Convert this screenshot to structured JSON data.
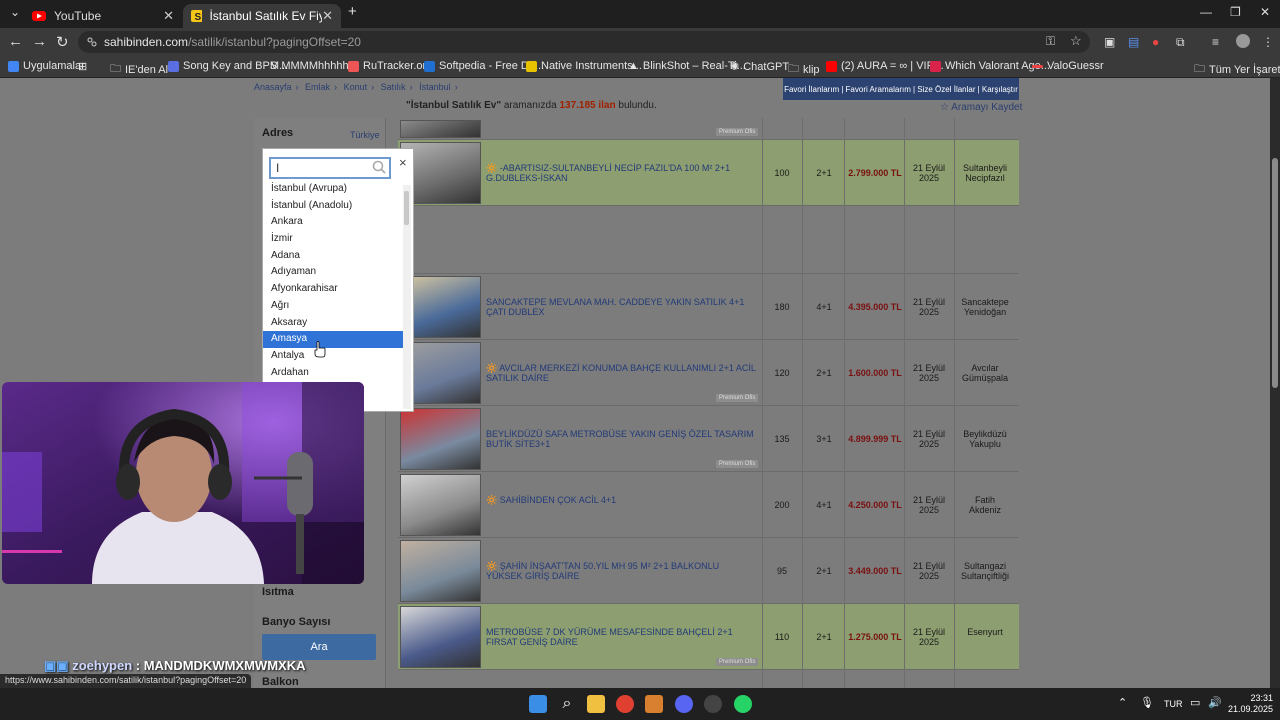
{
  "browser": {
    "tabs": [
      {
        "label": "YouTube",
        "active": false
      },
      {
        "label": "İstanbul Satılık Ev Fiyatları sahi",
        "active": true
      }
    ],
    "new_tab": "+",
    "url_domain": "sahibinden.com",
    "url_path": "/satilik/istanbul?pagingOffset=20",
    "bookmarks": [
      {
        "label": "Uygulamalar",
        "color": "#4285f4"
      },
      {
        "label": "IE'den Al",
        "color": "#e6c200"
      },
      {
        "label": "Song Key and BPM...",
        "color": "#5b6ee1"
      },
      {
        "label": "MMMMhhhhh",
        "color": "#ffffff"
      },
      {
        "label": "RuTracker.org",
        "color": "#e55"
      },
      {
        "label": "Softpedia - Free Do...",
        "color": "#1f6fd1"
      },
      {
        "label": "Native Instruments...",
        "color": "#e6c200"
      },
      {
        "label": "BlinkShot – Real-Ti...",
        "color": "#ffffff"
      },
      {
        "label": "ChatGPT",
        "color": "#cccccc"
      },
      {
        "label": "klip",
        "color": "#e6c200"
      },
      {
        "label": "(2) AURA = ∞ | VIR...",
        "color": "#ff0000"
      },
      {
        "label": "Which Valorant Age...",
        "color": "#d9234b"
      },
      {
        "label": "ValoGuessr",
        "color": "#e44"
      }
    ],
    "all_bookmarks": "Tüm Yer İşaretleri"
  },
  "site": {
    "breadcrumb": [
      "Anasayfa",
      "Emlak",
      "Konut",
      "Satılık",
      "İstanbul"
    ],
    "top_links": [
      "Favori İlanlarım",
      "Favori Aramalarım",
      "Size Özel İlanlar",
      "Karşılaştır"
    ],
    "result_query": "\"İstanbul Satılık Ev\"",
    "result_middle": " aramanızda ",
    "result_count": "137.185 ilan",
    "result_suffix": " bulundu.",
    "save_search": "Aramayı Kaydet"
  },
  "filters": {
    "adres_label": "Adres",
    "adres_value": "Türkiye",
    "isitma": "Isıtma",
    "banyo": "Banyo Sayısı",
    "ara": "Ara",
    "balkon": "Balkon"
  },
  "dropdown": {
    "search_value": "I",
    "close": "×",
    "items": [
      "İstanbul (Avrupa)",
      "İstanbul (Anadolu)",
      "Ankara",
      "İzmir",
      "Adana",
      "Adıyaman",
      "Afyonkarahisar",
      "Ağrı",
      "Aksaray",
      "Amasya",
      "Antalya",
      "Ardahan",
      "Artvin"
    ],
    "selected": "Amasya"
  },
  "listings": [
    {
      "title": "",
      "m2": "",
      "rooms": "",
      "price": "",
      "date1": "",
      "date2": "",
      "loc1": "",
      "loc2": "",
      "premium": "Premium Ofis",
      "highlight": false
    },
    {
      "title": "🔆 -ABARTISIZ-SULTANBEYLİ NECİP FAZIL'DA 100 M² 2+1 G.DUBLEKS-İSKAN",
      "m2": "100",
      "rooms": "2+1",
      "price": "2.799.000 TL",
      "date1": "21 Eylül",
      "date2": "2025",
      "loc1": "Sultanbeyli",
      "loc2": "Necipfazıl",
      "premium": "",
      "highlight": true
    },
    {
      "title": "SANCAKTEPE MEVLANA MAH. CADDEYE YAKIN SATILIK 4+1 ÇATI DUBLEX",
      "m2": "180",
      "rooms": "4+1",
      "price": "4.395.000 TL",
      "date1": "21 Eylül",
      "date2": "2025",
      "loc1": "Sancaktepe",
      "loc2": "Yenidoğan",
      "premium": "",
      "highlight": false
    },
    {
      "title": "🔆 AVCILAR MERKEZİ KONUMDA BAHÇE KULLANIMLI 2+1 ACİL SATILIK DAİRE",
      "m2": "120",
      "rooms": "2+1",
      "price": "1.600.000 TL",
      "date1": "21 Eylül",
      "date2": "2025",
      "loc1": "Avcılar",
      "loc2": "Gümüşpala",
      "premium": "Premium Ofis",
      "highlight": false
    },
    {
      "title": "BEYLİKDÜZÜ SAFA METROBÜSE YAKIN GENİŞ ÖZEL TASARIM BUTİK SİTE3+1",
      "m2": "135",
      "rooms": "3+1",
      "price": "4.899.999 TL",
      "date1": "21 Eylül",
      "date2": "2025",
      "loc1": "Beylikdüzü",
      "loc2": "Yakuplu",
      "premium": "Premium Ofis",
      "highlight": false
    },
    {
      "title": "🔆 SAHİBİNDEN ÇOK ACİL 4+1",
      "m2": "200",
      "rooms": "4+1",
      "price": "4.250.000 TL",
      "date1": "21 Eylül",
      "date2": "2025",
      "loc1": "Fatih",
      "loc2": "Akdeniz",
      "premium": "",
      "highlight": false
    },
    {
      "title": "🔆 ŞAHİN İNŞAAT'TAN 50.YIL MH 95 M² 2+1 BALKONLU YÜKSEK GİRİŞ DAİRE",
      "m2": "95",
      "rooms": "2+1",
      "price": "3.449.000 TL",
      "date1": "21 Eylül",
      "date2": "2025",
      "loc1": "Sultangazi",
      "loc2": "Sultançiftliği",
      "premium": "",
      "highlight": false
    },
    {
      "title": "METROBÜSE 7 DK YÜRÜME MESAFESİNDE BAHÇELİ 2+1 FIRSAT GENİŞ DAİRE",
      "m2": "110",
      "rooms": "2+1",
      "price": "1.275.000 TL",
      "date1": "21 Eylül",
      "date2": "2025",
      "loc1": "Esenyurt",
      "loc2": "",
      "premium": "Premium Ofis",
      "highlight": true
    }
  ],
  "overlay": {
    "chat_user": "zoehypen",
    "chat_msg": " : MANDMDKWMXMWMXKA",
    "status_url": "https://www.sahibinden.com/satilik/istanbul?pagingOffset=20"
  },
  "taskbar": {
    "lang": "TUR",
    "time": "23:31",
    "date": "21.09.2025"
  }
}
